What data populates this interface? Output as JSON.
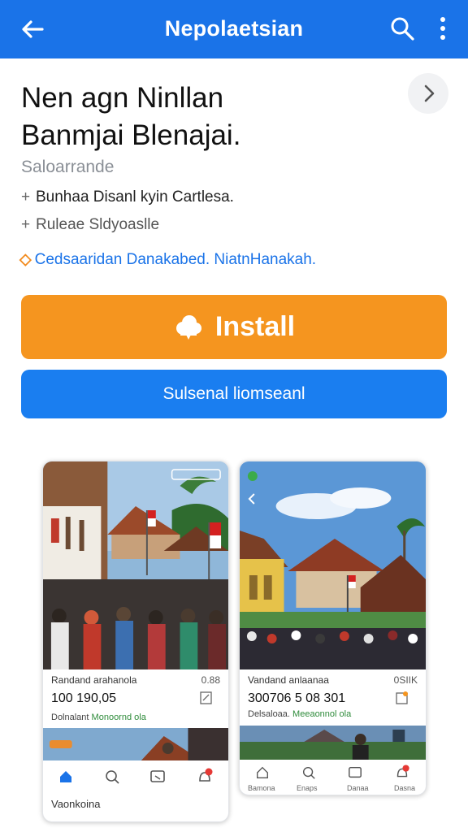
{
  "appbar": {
    "title": "Nepolaetsian",
    "back_icon": "arrow-left-icon",
    "search_icon": "search-icon",
    "more_icon": "more-vertical-icon",
    "color": "#1a73e8"
  },
  "app": {
    "name_line1": "Nen agn Ninllan",
    "name_line2": "Banmjai Blenajai.",
    "developer": "Saloarrande",
    "meta1": "Bunhaa Disanl kyin Cartlesa.",
    "meta2": "Ruleae Sldyoaslle",
    "link": "Cedsaaridan Danakabed. NiatnHanakah."
  },
  "buttons": {
    "install": "Install",
    "install_color": "#f5951f",
    "secondary": "Sulsenal liomseanl",
    "secondary_color": "#1a7ef0"
  },
  "screenshots": [
    {
      "caption": "Randand arahanola",
      "caption_right": "0.88",
      "price": "100 190,05",
      "sub_label": "Dolnalant",
      "sub_green": "Monoornd ola",
      "nav_label": "Vaonkoina"
    },
    {
      "caption": "Vandand anlaanaa",
      "caption_right": "0SIIK",
      "price": "300706 5 08 301",
      "sub_label": "Delsaloaa.",
      "sub_green": "Meeaonnol ola",
      "nav_labels": [
        "Bamona",
        "Enaps",
        "Danaa",
        "Dasna"
      ]
    }
  ]
}
